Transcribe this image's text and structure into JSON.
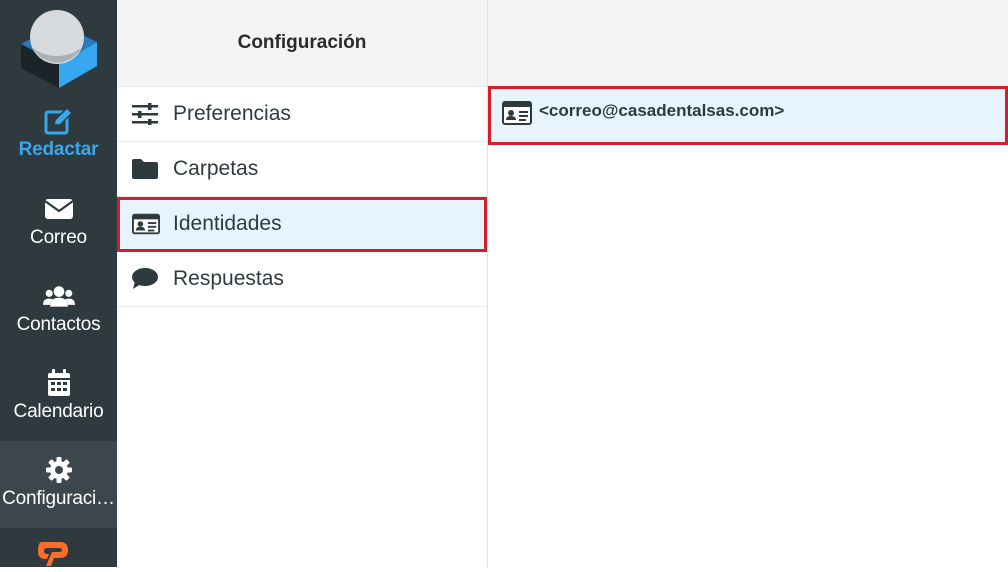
{
  "nav": {
    "items": [
      {
        "label": "Redactar",
        "icon": "compose-icon"
      },
      {
        "label": "Correo",
        "icon": "envelope-icon"
      },
      {
        "label": "Contactos",
        "icon": "users-icon"
      },
      {
        "label": "Calendario",
        "icon": "calendar-icon"
      },
      {
        "label": "Configuraci…",
        "icon": "gear-icon"
      }
    ],
    "accent_color": "#37a7f0",
    "background_color": "#2f3a3f"
  },
  "settings": {
    "title": "Configuración",
    "items": [
      {
        "label": "Preferencias",
        "icon": "sliders-icon"
      },
      {
        "label": "Carpetas",
        "icon": "folder-icon"
      },
      {
        "label": "Identidades",
        "icon": "id-card-icon"
      },
      {
        "label": "Respuestas",
        "icon": "speech-bubble-icon"
      }
    ],
    "active_item": "Identidades",
    "highlight_color": "#d51f2c"
  },
  "identities": {
    "items": [
      {
        "label": "<correo@casadentalsas.com>",
        "icon": "id-card-icon"
      }
    ]
  }
}
